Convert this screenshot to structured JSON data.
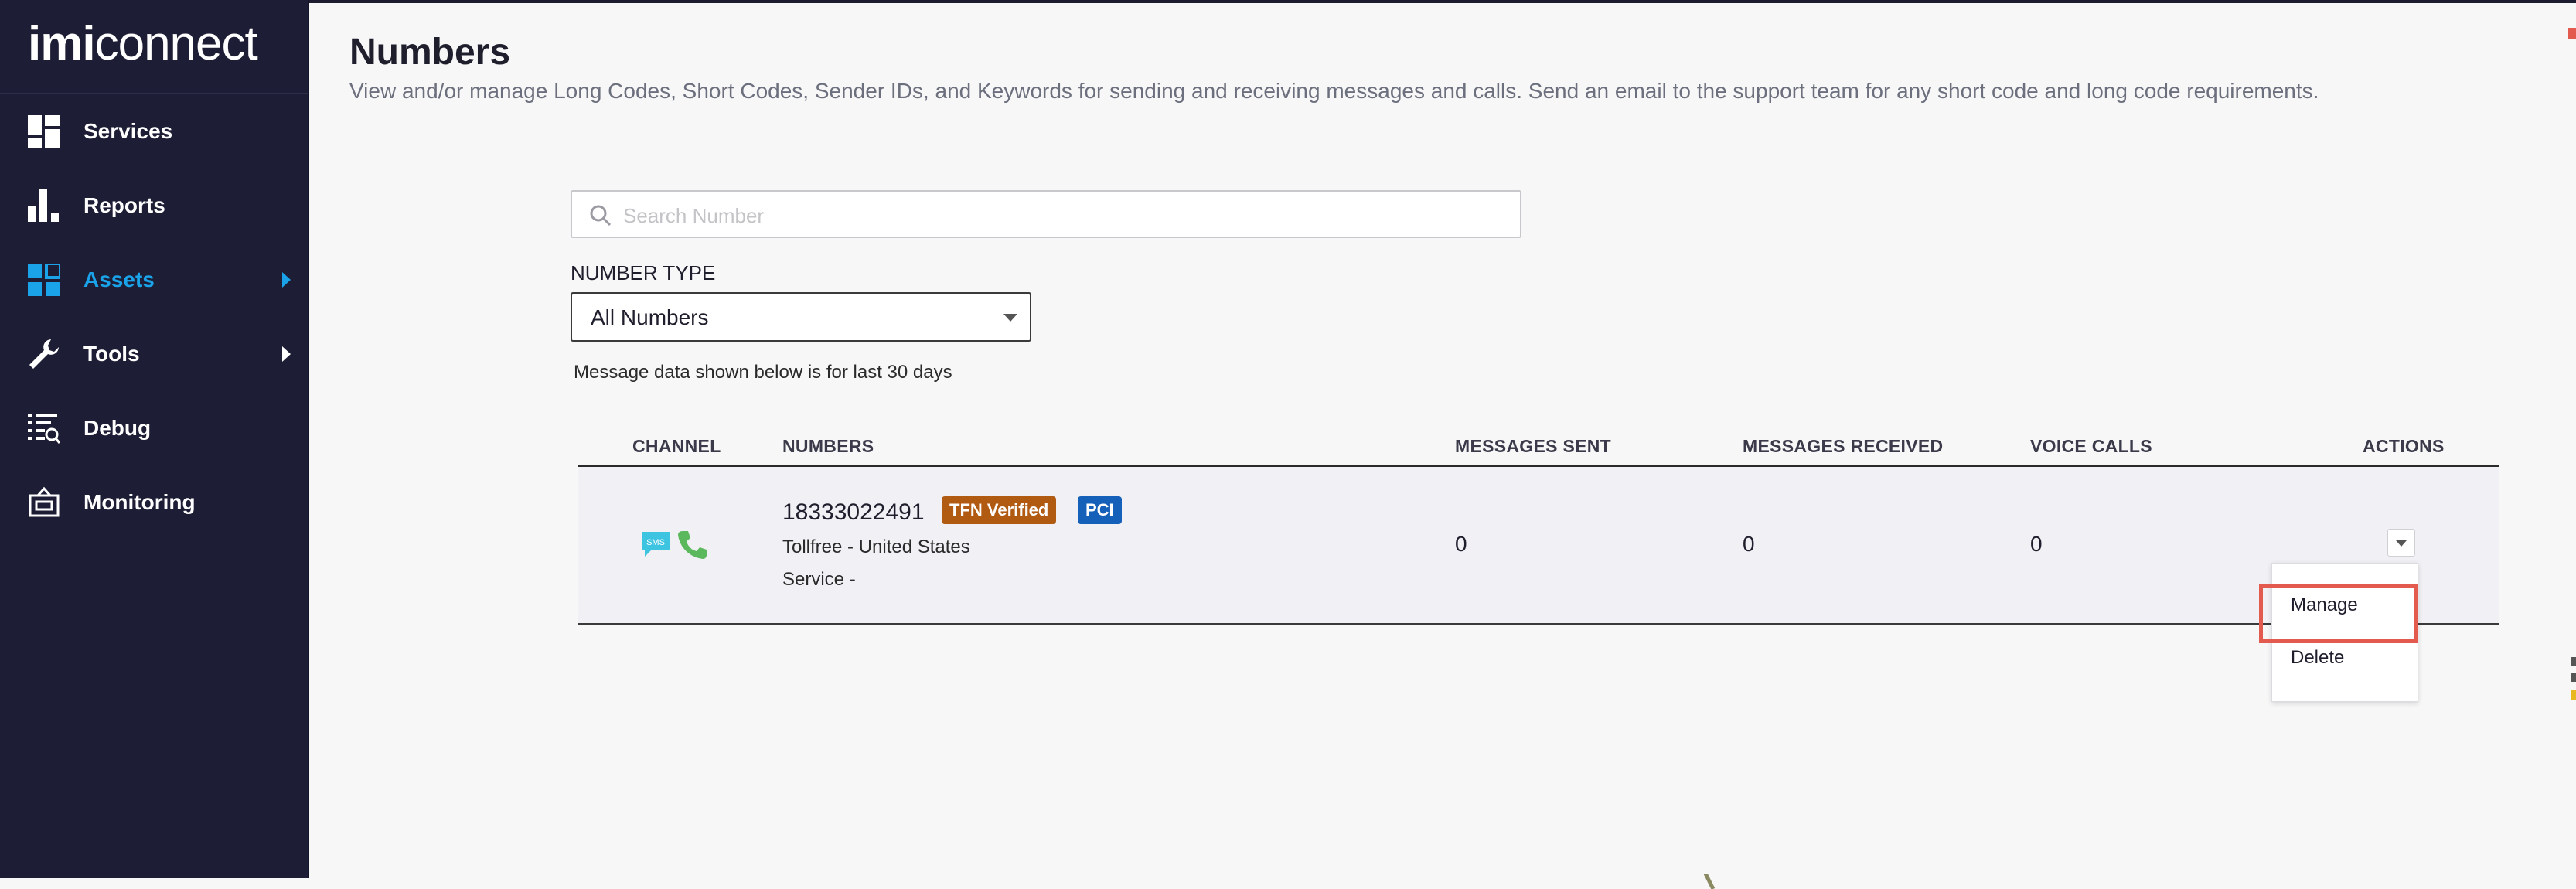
{
  "app": {
    "logo_bold": "imi",
    "logo_light": "connect"
  },
  "sidebar": {
    "items": [
      {
        "label": "Services",
        "icon": "dashboard-icon",
        "active": false
      },
      {
        "label": "Reports",
        "icon": "bar-chart-icon",
        "active": false
      },
      {
        "label": "Assets",
        "icon": "grid-icon",
        "active": true
      },
      {
        "label": "Tools",
        "icon": "wrench-icon",
        "active": false
      },
      {
        "label": "Debug",
        "icon": "debug-list-icon",
        "active": false
      },
      {
        "label": "Monitoring",
        "icon": "monitor-icon",
        "active": false
      }
    ]
  },
  "page": {
    "title": "Numbers",
    "description": "View and/or manage Long Codes, Short Codes, Sender IDs, and Keywords for sending and receiving messages and calls. Send an email to the support team for any short code and long code requirements."
  },
  "search": {
    "placeholder": "Search Number",
    "value": ""
  },
  "filter": {
    "label": "NUMBER TYPE",
    "selected": "All Numbers"
  },
  "note": "Message data shown below is for last 30 days",
  "table": {
    "columns": [
      "CHANNEL",
      "NUMBERS",
      "MESSAGES SENT",
      "MESSAGES RECEIVED",
      "VOICE CALLS",
      "ACTIONS"
    ],
    "rows": [
      {
        "channels": [
          "sms-icon",
          "phone-icon"
        ],
        "number": "18333022491",
        "badges": [
          "TFN Verified",
          "PCI"
        ],
        "type": "Tollfree - United States",
        "service": "Service -",
        "messages_sent": "0",
        "messages_received": "0",
        "voice_calls": "0"
      }
    ]
  },
  "actions_menu": {
    "items": [
      "Manage",
      "Delete"
    ],
    "highlighted": "Manage"
  },
  "colors": {
    "sidebar_bg": "#1d1d35",
    "active_accent": "#1aa3e8",
    "badge_tfn": "#b05a12",
    "badge_pci": "#1560b8",
    "highlight": "#e35b4f"
  }
}
